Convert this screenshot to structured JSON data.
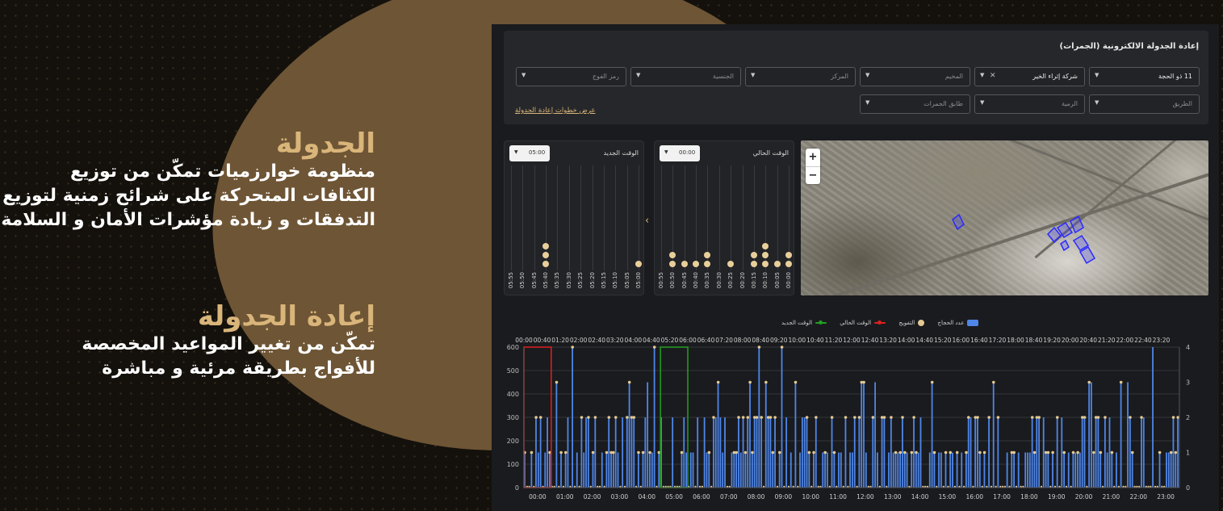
{
  "promo": {
    "section1": {
      "heading": "الجدولة",
      "lines": [
        "منظومة خوارزميات تمكّن من توزيع",
        "الكثافات المتحركة على شرائح زمنية لتوزيع",
        "التدفقات و زيادة مؤشرات الأمان و السلامة"
      ]
    },
    "section2": {
      "heading": "إعادة الجدولة",
      "lines": [
        "تمكّن من تغيير المواعيد المخصصة",
        "للأفواج بطريقة مرئية و مباشرة"
      ]
    }
  },
  "app": {
    "title": "إعادة الجدولة الالكترونية (الجمرات)",
    "filters_row1": [
      {
        "id": "day",
        "value": "11 ذو الحجة",
        "filled": true
      },
      {
        "id": "company",
        "value": "شركة إثراء الخير",
        "filled": true,
        "clearable": true
      },
      {
        "id": "camp",
        "value": "المخيم",
        "filled": false
      },
      {
        "id": "center",
        "value": "المركز",
        "filled": false
      },
      {
        "id": "nationality",
        "value": "الجنسية",
        "filled": false
      },
      {
        "id": "group-code",
        "value": "رمز الفوج",
        "filled": false
      }
    ],
    "filters_row2": [
      {
        "id": "route",
        "value": "الطريق",
        "filled": false
      },
      {
        "id": "throw",
        "value": "الرمية",
        "filled": false
      },
      {
        "id": "jamarat-floor",
        "value": "طابق الجمرات",
        "filled": false
      }
    ],
    "show_steps_link": "عرض خطوات إعادة الجدولة",
    "new_time": {
      "title": "الوقت الجديد",
      "picker_value": "05:00",
      "times": [
        "05:55",
        "05:50",
        "05:45",
        "05:40",
        "05:35",
        "05:30",
        "05:25",
        "05:20",
        "05:15",
        "05:10",
        "05:05",
        "05:00"
      ],
      "counts": [
        0,
        0,
        0,
        3,
        0,
        0,
        0,
        0,
        0,
        0,
        0,
        1
      ]
    },
    "current_time": {
      "title": "الوقت الحالي",
      "picker_value": "00:00",
      "times": [
        "00:55",
        "00:50",
        "00:45",
        "00:40",
        "00:35",
        "00:30",
        "00:25",
        "00:20",
        "00:15",
        "00:10",
        "00:05",
        "00:00"
      ],
      "counts": [
        0,
        2,
        1,
        1,
        2,
        0,
        1,
        0,
        2,
        3,
        1,
        2
      ]
    },
    "map": {
      "zoom_in": "+",
      "zoom_out": "−"
    },
    "legend": {
      "pilgrims": "عدد الحجاج",
      "groups": "التفويج",
      "current_time": "الوقت الحالي",
      "new_time": "الوقت الجديد"
    },
    "colors": {
      "bars": "#4f86e8",
      "dots": "#e3c992",
      "current": "#e02020",
      "new": "#22a022",
      "accent": "#d9b57a"
    }
  },
  "chart_data": {
    "type": "bar",
    "top_axis_labels": [
      "00:00",
      "00:40",
      "01:20",
      "02:00",
      "02:40",
      "03:20",
      "04:00",
      "04:40",
      "05:20",
      "06:00",
      "06:40",
      "07:20",
      "08:00",
      "08:40",
      "09:20",
      "10:00",
      "10:40",
      "11:20",
      "12:00",
      "12:40",
      "13:20",
      "14:00",
      "14:40",
      "15:20",
      "16:00",
      "16:40",
      "17:20",
      "18:00",
      "18:40",
      "19:20",
      "20:00",
      "20:40",
      "21:20",
      "22:00",
      "22:40",
      "23:20"
    ],
    "bottom_axis_labels": [
      "00:00",
      "01:00",
      "02:00",
      "03:00",
      "04:00",
      "05:00",
      "06:00",
      "07:00",
      "08:00",
      "09:00",
      "10:00",
      "11:00",
      "12:00",
      "13:00",
      "14:00",
      "15:00",
      "16:00",
      "17:00",
      "18:00",
      "19:00",
      "20:00",
      "21:00",
      "22:00",
      "23:00"
    ],
    "y_left_ticks": [
      "600",
      "500",
      "400",
      "300",
      "200",
      "100",
      "0"
    ],
    "y_right_ticks": [
      "4",
      "3",
      "2",
      "1",
      "0"
    ],
    "ylim_left": [
      0,
      600
    ],
    "ylim_right": [
      0,
      4
    ],
    "x_range_minutes": [
      0,
      1440
    ],
    "bar_interval_minutes": 5,
    "bar_value_levels": [
      0,
      150,
      300,
      450,
      600
    ],
    "dot_value_levels": [
      0,
      1,
      2,
      3,
      4
    ],
    "current_time_highlight": {
      "start": "00:00",
      "end": "01:00"
    },
    "new_time_highlight": {
      "start": "05:00",
      "end": "06:00"
    },
    "series": [
      {
        "name": "عدد الحجاج",
        "kind": "bars"
      },
      {
        "name": "التفويج",
        "kind": "dots"
      }
    ]
  }
}
